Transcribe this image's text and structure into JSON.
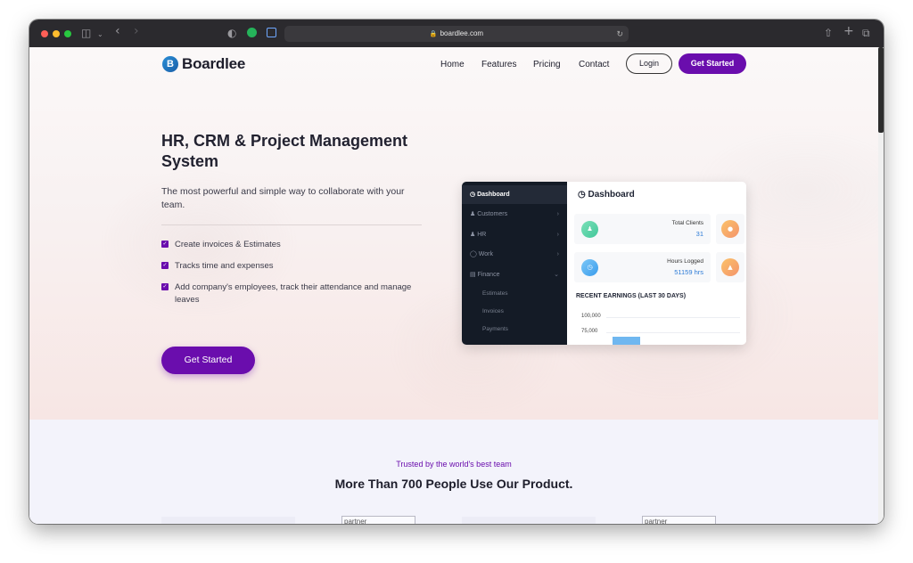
{
  "browser": {
    "url": "boardlee.com"
  },
  "site": {
    "logo_text": "Boardlee",
    "logo_mark": "B",
    "nav": {
      "items": [
        "Home",
        "Features",
        "Pricing",
        "Contact"
      ],
      "login": "Login",
      "get_started": "Get Started"
    }
  },
  "hero": {
    "title": "HR, CRM & Project Management System",
    "subtitle": "The most powerful and simple way to collaborate with your team.",
    "features": [
      "Create invoices & Estimates",
      "Tracks time and expenses",
      "Add company's employees, track their attendance and manage leaves"
    ],
    "cta": "Get Started"
  },
  "dashboard_preview": {
    "sidebar": {
      "items": [
        "Dashboard",
        "Customers",
        "HR",
        "Work",
        "Finance"
      ],
      "finance_subitems": [
        "Estimates",
        "Invoices",
        "Payments"
      ]
    },
    "title": "Dashboard",
    "stats": [
      {
        "label": "Total Clients",
        "value": "31"
      },
      {
        "label": "Hours Logged",
        "value": "51159 hrs"
      }
    ],
    "earnings_title": "RECENT EARNINGS (LAST 30 DAYS)",
    "earnings_ticks": [
      "100,000",
      "75,000"
    ],
    "colors": {
      "sidebar": "#141b26",
      "bar": "#6fb7f0",
      "green_icon": "#5fd3a8",
      "blue_icon": "#4aa8f0",
      "orange_icon": "#f4946b"
    }
  },
  "trusted": {
    "kicker": "Trusted by the world's best team",
    "title": "More Than 700 People Use Our Product.",
    "partner_labels": [
      "partner",
      "partner"
    ]
  },
  "colors": {
    "brand_purple": "#6a0dad",
    "brand_blue": "#2a8fd6"
  }
}
